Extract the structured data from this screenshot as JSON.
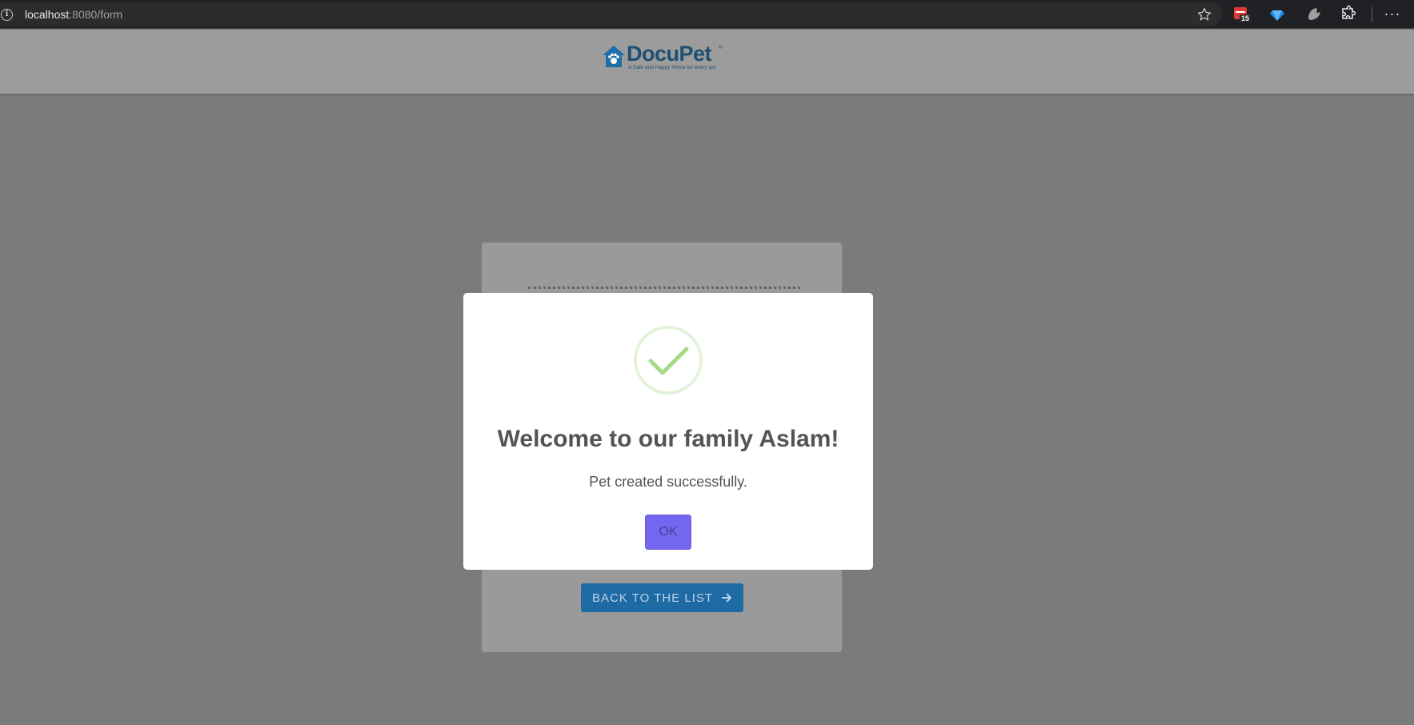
{
  "browser": {
    "url_host": "localhost",
    "url_rest": ":8080/form",
    "badge_count": "15"
  },
  "header": {
    "logo_text": "DocuPet",
    "logo_tagline": "A Safe and Happy Home for every pet"
  },
  "card": {
    "back_button_label": "BACK TO THE LIST"
  },
  "modal": {
    "title": "Welcome to our family Aslam!",
    "message": "Pet created successfully.",
    "ok_label": "OK"
  },
  "colors": {
    "accent": "#7367f0",
    "success": "#a5dc86",
    "primary": "#1e6aa5"
  }
}
